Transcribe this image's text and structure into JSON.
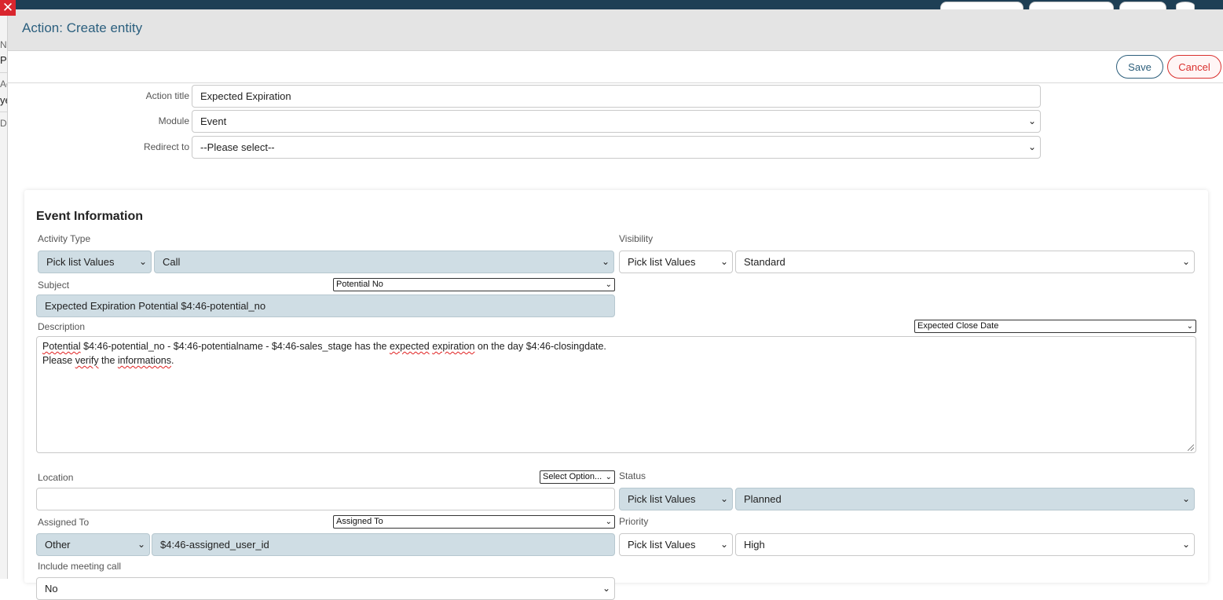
{
  "background": {
    "fragments": [
      "N",
      "Po",
      "Ac",
      "ye",
      "D"
    ]
  },
  "modal": {
    "title": "Action: Create entity",
    "save_label": "Save",
    "cancel_label": "Cancel",
    "close_glyph": "✕"
  },
  "form": {
    "action_title": {
      "label": "Action title",
      "value": "Expected Expiration"
    },
    "module": {
      "label": "Module",
      "value": "Event"
    },
    "redirect": {
      "label": "Redirect to",
      "value": "--Please select--"
    }
  },
  "event": {
    "title": "Event Information",
    "activity_type": {
      "label": "Activity Type",
      "mode": "Pick list Values",
      "value": "Call"
    },
    "visibility": {
      "label": "Visibility",
      "mode": "Pick list Values",
      "value": "Standard"
    },
    "subject": {
      "label": "Subject",
      "field_picker": "Potential No",
      "value": "Expected Expiration Potential $4:46-potential_no"
    },
    "description": {
      "label": "Description",
      "field_picker": "Expected Close Date",
      "line1_a": "Potential",
      "line1_b": " $4:46-potential_no - $4:46-potentialname - $4:46-sales_stage has the ",
      "line1_c": "expected",
      "line1_d": " ",
      "line1_e": "expiration",
      "line1_f": " on the day $4:46-closingdate.",
      "line2_a": "Please ",
      "line2_b": "verify",
      "line2_c": " the ",
      "line2_d": "informations",
      "line2_e": "."
    },
    "location": {
      "label": "Location",
      "field_picker": "Select Option...",
      "value": ""
    },
    "status": {
      "label": "Status",
      "mode": "Pick list Values",
      "value": "Planned"
    },
    "assigned_to": {
      "label": "Assigned To",
      "field_picker": "Assigned To",
      "mode": "Other",
      "value": "$4:46-assigned_user_id"
    },
    "priority": {
      "label": "Priority",
      "mode": "Pick list Values",
      "value": "High"
    },
    "include_meeting_call": {
      "label": "Include meeting call",
      "value": "No"
    }
  },
  "icons": {
    "caret": "chevron-down-icon",
    "close": "close-icon"
  },
  "colors": {
    "accent": "#2b5f7e",
    "danger": "#d9302e",
    "field_highlight": "#cfdde4",
    "header_bg": "#e4e4e4"
  }
}
